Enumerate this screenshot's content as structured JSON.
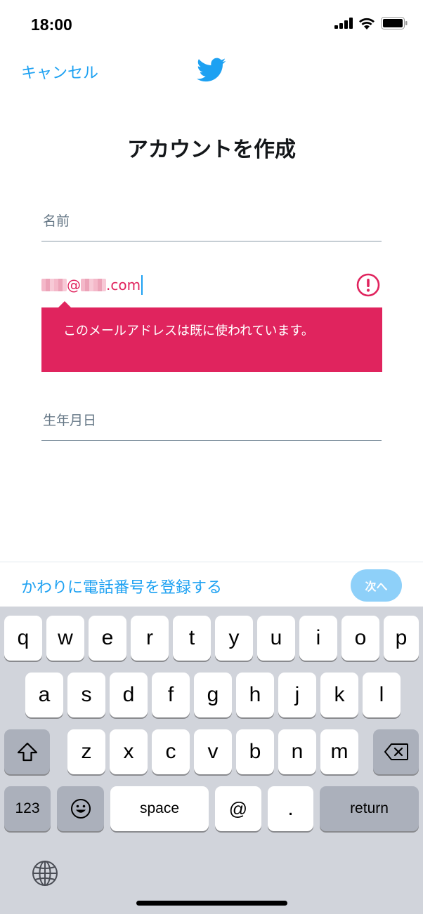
{
  "status_bar": {
    "time": "18:00"
  },
  "header": {
    "cancel_label": "キャンセル",
    "logo_icon": "twitter-bird-icon"
  },
  "title": "アカウントを作成",
  "form": {
    "name_placeholder": "名前",
    "email": {
      "local_part_masked": true,
      "at_sign": "@",
      "domain_suffix": ".com"
    },
    "error_message": "このメールアドレスは既に使われています。",
    "birthdate_placeholder": "生年月日"
  },
  "action_bar": {
    "alt_link": "かわりに電話番号を登録する",
    "next_label": "次へ"
  },
  "keyboard": {
    "row1": [
      "q",
      "w",
      "e",
      "r",
      "t",
      "y",
      "u",
      "i",
      "o",
      "p"
    ],
    "row2": [
      "a",
      "s",
      "d",
      "f",
      "g",
      "h",
      "j",
      "k",
      "l"
    ],
    "row3": [
      "z",
      "x",
      "c",
      "v",
      "b",
      "n",
      "m"
    ],
    "numbers_label": "123",
    "space_label": "space",
    "at_label": "@",
    "dot_label": ".",
    "return_label": "return"
  },
  "colors": {
    "accent": "#1da1f2",
    "error": "#e0245e",
    "next_disabled": "#8ed0f9",
    "keyboard_bg": "#d1d4db"
  }
}
